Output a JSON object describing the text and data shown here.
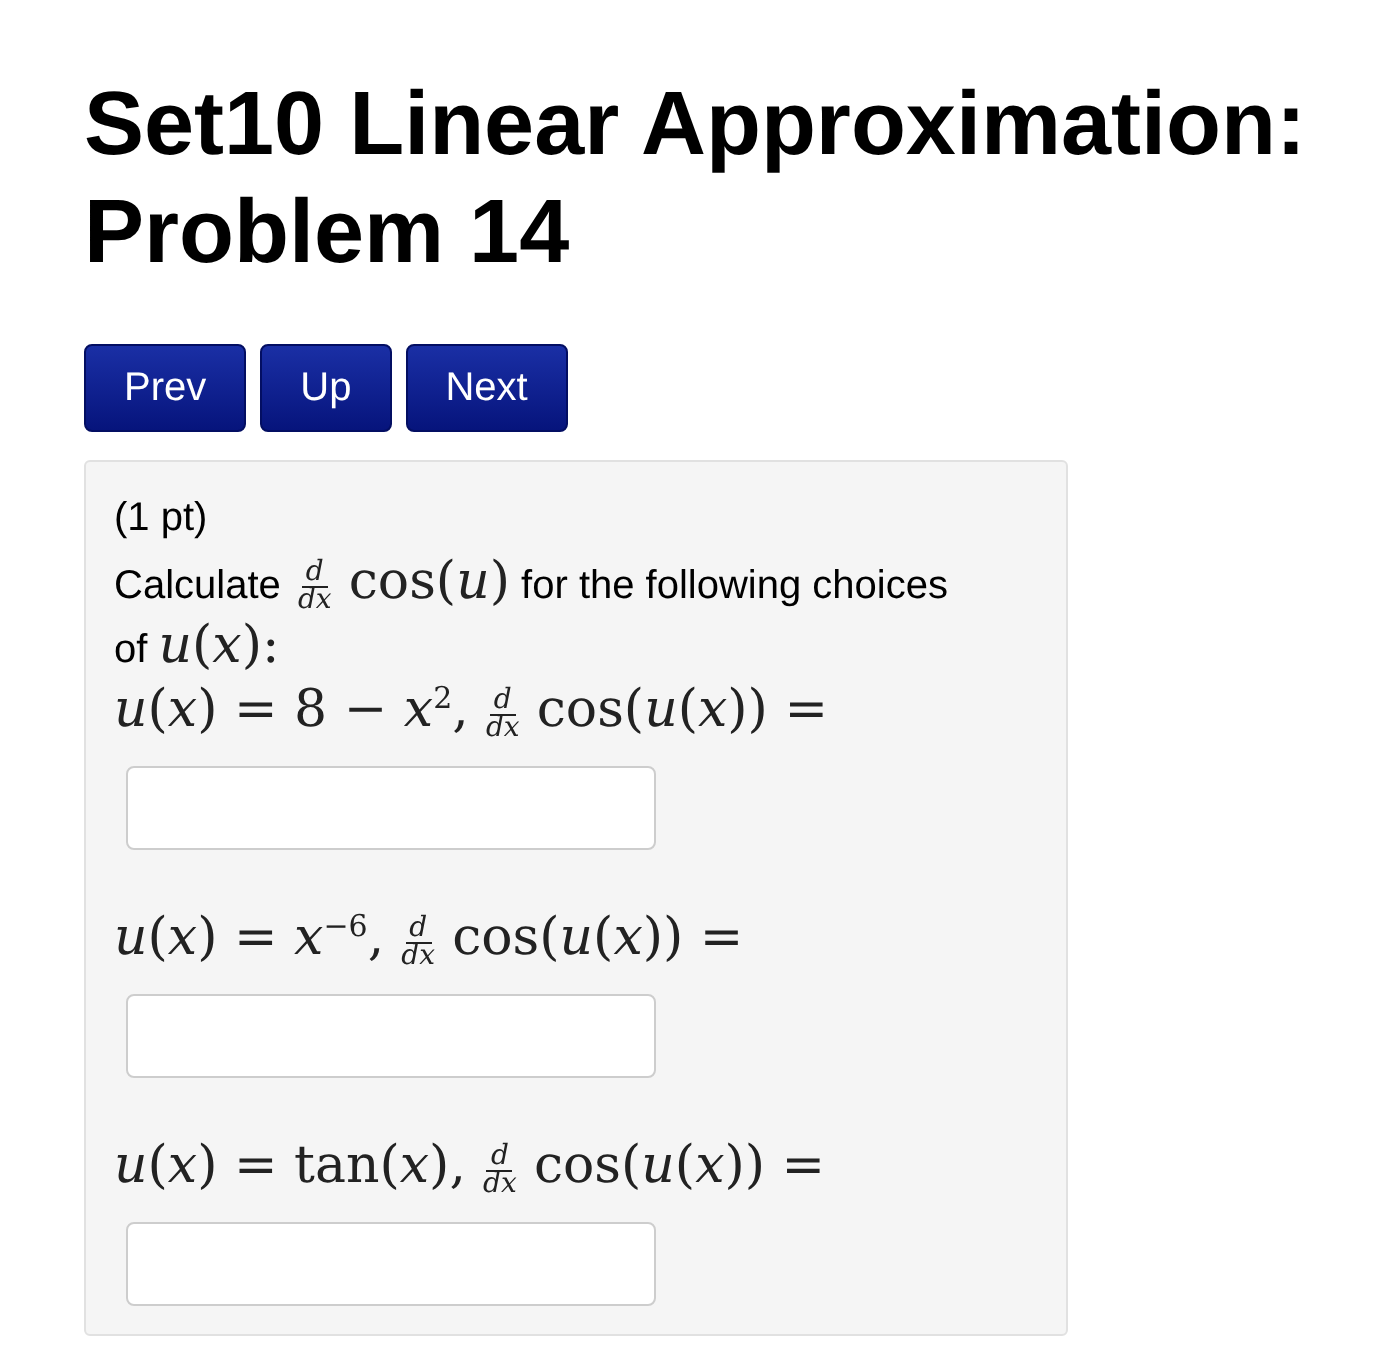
{
  "title": "Set10 Linear Approximation: Problem 14",
  "nav_buttons": [
    "Prev",
    "Up",
    "Next"
  ],
  "problem": {
    "points": "(1 pt)",
    "prompt": [
      {
        "kind": "text",
        "text": "Calculate"
      },
      {
        "kind": "frac",
        "num": "d",
        "den": "dx"
      },
      {
        "kind": "math",
        "text": "cos(*u*)"
      },
      {
        "kind": "text",
        "text": "for the following choices of"
      },
      {
        "kind": "math",
        "text": "*u*(*x*):"
      }
    ],
    "questions": [
      {
        "expression": [
          {
            "kind": "math",
            "text": "*u*(*x*) = 8 − *x*$^{2}$,"
          },
          {
            "kind": "frac",
            "num": "d",
            "den": "dx"
          },
          {
            "kind": "math",
            "text": "cos(*u*(*x*)) ="
          }
        ]
      },
      {
        "expression": [
          {
            "kind": "math",
            "text": "*u*(*x*) = *x*$^{−6}$,"
          },
          {
            "kind": "frac",
            "num": "d",
            "den": "dx"
          },
          {
            "kind": "math",
            "text": "cos(*u*(*x*)) ="
          }
        ]
      },
      {
        "expression": [
          {
            "kind": "math",
            "text": "*u*(*x*) = tan(*x*),"
          },
          {
            "kind": "frac",
            "num": "d",
            "den": "dx"
          },
          {
            "kind": "math",
            "text": "cos(*u*(*x*)) ="
          }
        ]
      }
    ]
  }
}
